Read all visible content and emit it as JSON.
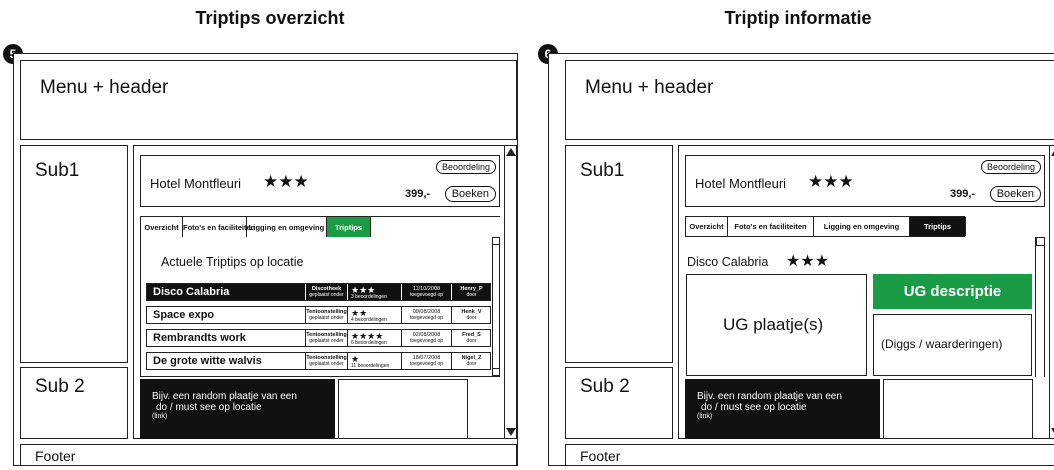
{
  "left": {
    "title": "Triptips overzicht",
    "badge": "5",
    "header": "Menu + header",
    "sub1": "Sub1",
    "sub2": "Sub 2",
    "footer": "Footer",
    "hotel": {
      "name": "Hotel Montfleuri",
      "stars": "★★★",
      "price": "399,-",
      "rating_button": "Beoordeling",
      "book_button": "Boeken"
    },
    "tabs": [
      "Overzicht",
      "Foto's en faciliteiten",
      "Ligging en omgeving",
      "Triptips"
    ],
    "section_title": "Actuele Triptips op locatie",
    "rows": [
      {
        "name": "Disco Calabria",
        "type": "Discotheek",
        "sub": "geplaatst onder",
        "stars": "★★★",
        "reviews": "3 beoordelingen",
        "date": "11/10/2008",
        "date_sub": "toegevoegd op",
        "user": "Henry_P",
        "user_sub": "door"
      },
      {
        "name": "Space expo",
        "type": "Tentoonstelling",
        "sub": "geplaatst onder",
        "stars": "★★",
        "reviews": "4 beoordelingen",
        "date": "09/08/2008",
        "date_sub": "toegevoegd op",
        "user": "Henk_V",
        "user_sub": "door"
      },
      {
        "name": "Rembrandts work",
        "type": "Tentoonstelling",
        "sub": "geplaatst onder",
        "stars": "★★★★",
        "reviews": "6 beoordelingen",
        "date": "02/08/2008",
        "date_sub": "toegevoegd op",
        "user": "Fred_S",
        "user_sub": "door"
      },
      {
        "name": "De grote witte walvis",
        "type": "Tentoonstelling",
        "sub": "geplaatst onder",
        "stars": "★",
        "reviews": "11 beoordelingen",
        "date": "18/07/2008",
        "date_sub": "toegevoegd op",
        "user": "Nigel_Z",
        "user_sub": "door"
      }
    ],
    "promo_line1": "Bijv. een random plaatje van een",
    "promo_line2": "do / must see op locatie",
    "promo_link": "(link)"
  },
  "right": {
    "title": "Triptip informatie",
    "badge": "6",
    "header": "Menu + header",
    "sub1": "Sub1",
    "sub2": "Sub 2",
    "footer": "Footer",
    "hotel": {
      "name": "Hotel Montfleuri",
      "stars": "★★★",
      "price": "399,-",
      "rating_button": "Beoordeling",
      "book_button": "Boeken"
    },
    "tabs": [
      "Overzicht",
      "Foto's en faciliteiten",
      "Ligging en omgeving",
      "Triptips"
    ],
    "item_name": "Disco Calabria",
    "item_stars": "★★★",
    "image_label": "UG plaatje(s)",
    "description_label": "UG descriptie",
    "diggs_label": "(Diggs / waarderingen)",
    "promo_line1": "Bijv. een random plaatje van een",
    "promo_line2": "do / must see op locatie",
    "promo_link": "(link)"
  },
  "colors": {
    "accent_green": "#1a9c47",
    "ink": "#111111"
  }
}
